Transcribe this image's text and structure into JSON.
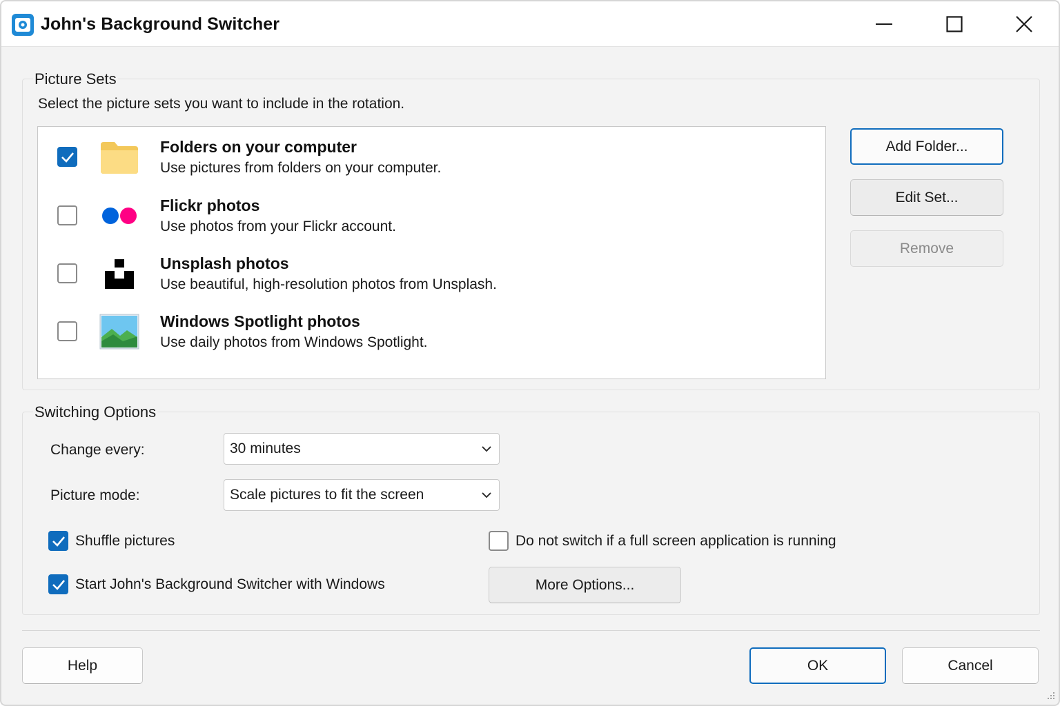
{
  "window": {
    "title": "John's Background Switcher",
    "app_icon": "jbs-app-icon",
    "controls": [
      "minimize-icon",
      "maximize-icon",
      "close-icon"
    ]
  },
  "picture_sets": {
    "group_title": "Picture Sets",
    "instruction": "Select the picture sets you want to include in the rotation.",
    "items": [
      {
        "title": "Folders on your computer",
        "description": "Use pictures from folders on your computer.",
        "checked": true,
        "icon": "folder-icon"
      },
      {
        "title": "Flickr photos",
        "description": "Use photos from your Flickr account.",
        "checked": false,
        "icon": "flickr-icon"
      },
      {
        "title": "Unsplash photos",
        "description": "Use beautiful, high-resolution photos from Unsplash.",
        "checked": false,
        "icon": "unsplash-icon"
      },
      {
        "title": "Windows Spotlight photos",
        "description": "Use daily photos from Windows Spotlight.",
        "checked": false,
        "icon": "spotlight-picture-icon"
      }
    ],
    "buttons": {
      "add_folder": "Add Folder...",
      "edit_set": "Edit Set...",
      "remove": "Remove"
    }
  },
  "switching_options": {
    "group_title": "Switching Options",
    "change_every_label": "Change every:",
    "change_every_value": "30 minutes",
    "picture_mode_label": "Picture mode:",
    "picture_mode_value": "Scale pictures to fit the screen",
    "shuffle_label": "Shuffle pictures",
    "shuffle_checked": true,
    "start_with_windows_label": "Start John's Background Switcher with Windows",
    "start_with_windows_checked": true,
    "no_fullscreen_label": "Do not switch if a full screen application is running",
    "no_fullscreen_checked": false,
    "more_options": "More Options..."
  },
  "footer": {
    "help": "Help",
    "ok": "OK",
    "cancel": "Cancel"
  },
  "colors": {
    "accent": "#0f6cbd",
    "window_bg": "#f3f3f3",
    "folder": "#fbd97a",
    "flickr_blue": "#0063dc",
    "flickr_pink": "#ff0084"
  }
}
